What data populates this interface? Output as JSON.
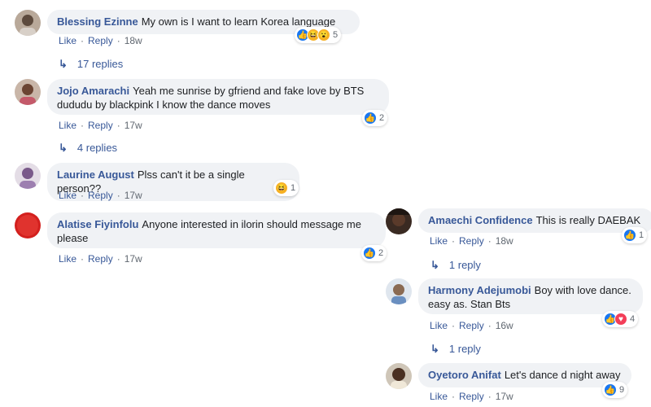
{
  "actions": {
    "like": "Like",
    "reply": "Reply",
    "sep": "·"
  },
  "left": [
    {
      "name": "Blessing Ezinne",
      "text": "My own is I want to learn Korea language",
      "time": "18w",
      "reactions": [
        "like",
        "haha",
        "wow"
      ],
      "react_count": "5",
      "replies": "17 replies"
    },
    {
      "name": "Jojo Amarachi",
      "text": "Yeah me sunrise by gfriend and fake love by BTS dududu by blackpink I know the dance moves",
      "time": "17w",
      "reactions": [
        "like"
      ],
      "react_count": "2",
      "replies": "4 replies"
    },
    {
      "name": "Laurine August",
      "text": "Plss can't it be a single person??",
      "time": "17w",
      "reactions": [
        "haha"
      ],
      "react_count": "1"
    },
    {
      "name": "Alatise Fiyinfolu",
      "text": "Anyone interested in ilorin should message me please",
      "time": "17w",
      "reactions": [
        "like"
      ],
      "react_count": "2"
    }
  ],
  "right": [
    {
      "name": "Amaechi Confidence",
      "text": "This is really DAEBAK",
      "time": "18w",
      "reactions": [
        "like"
      ],
      "react_count": "1",
      "replies": "1 reply"
    },
    {
      "name": "Harmony Adejumobi",
      "text": "Boy with love dance. easy as. Stan Bts",
      "time": "16w",
      "reactions": [
        "like",
        "love"
      ],
      "react_count": "4",
      "replies": "1 reply"
    },
    {
      "name": "Oyetoro Anifat",
      "text": "Let's dance d night away",
      "time": "17w",
      "reactions": [
        "like"
      ],
      "react_count": "9"
    }
  ],
  "colors": {
    "link": "#385898",
    "bubble": "#f0f2f5",
    "like": "#1877f2",
    "love": "#f33e58",
    "haha": "#f7b125"
  },
  "icons": {
    "reply_arrow": "↳",
    "like": "thumbs-up-icon",
    "haha": "laughing-face-icon",
    "wow": "surprised-face-icon",
    "love": "heart-icon"
  }
}
